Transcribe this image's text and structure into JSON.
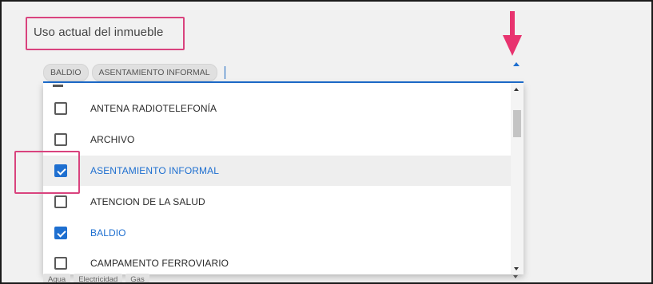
{
  "field": {
    "label": "Uso actual del inmueble",
    "selected_chips": [
      "BALDIO",
      "ASENTAMIENTO INFORMAL"
    ]
  },
  "dropdown": {
    "options": [
      {
        "label": "ANTENA RADIOTELEFONÍA",
        "checked": false
      },
      {
        "label": "ARCHIVO",
        "checked": false
      },
      {
        "label": "ASENTAMIENTO INFORMAL",
        "checked": true
      },
      {
        "label": "ATENCION DE LA SALUD",
        "checked": false
      },
      {
        "label": "BALDIO",
        "checked": true
      },
      {
        "label": "CAMPAMENTO FERROVIARIO",
        "checked": false
      }
    ]
  },
  "services": {
    "chips": [
      "Agua",
      "Electricidad",
      "Gas"
    ]
  },
  "colors": {
    "accent": "#1e6fd0",
    "annotation": "#d9437e",
    "chip_bg": "#e0e0e0"
  },
  "icons": {
    "annotation_arrow": "down-arrow-icon",
    "dropdown_toggle": "chevron-up-icon",
    "checkbox": "checkbox-icon"
  }
}
